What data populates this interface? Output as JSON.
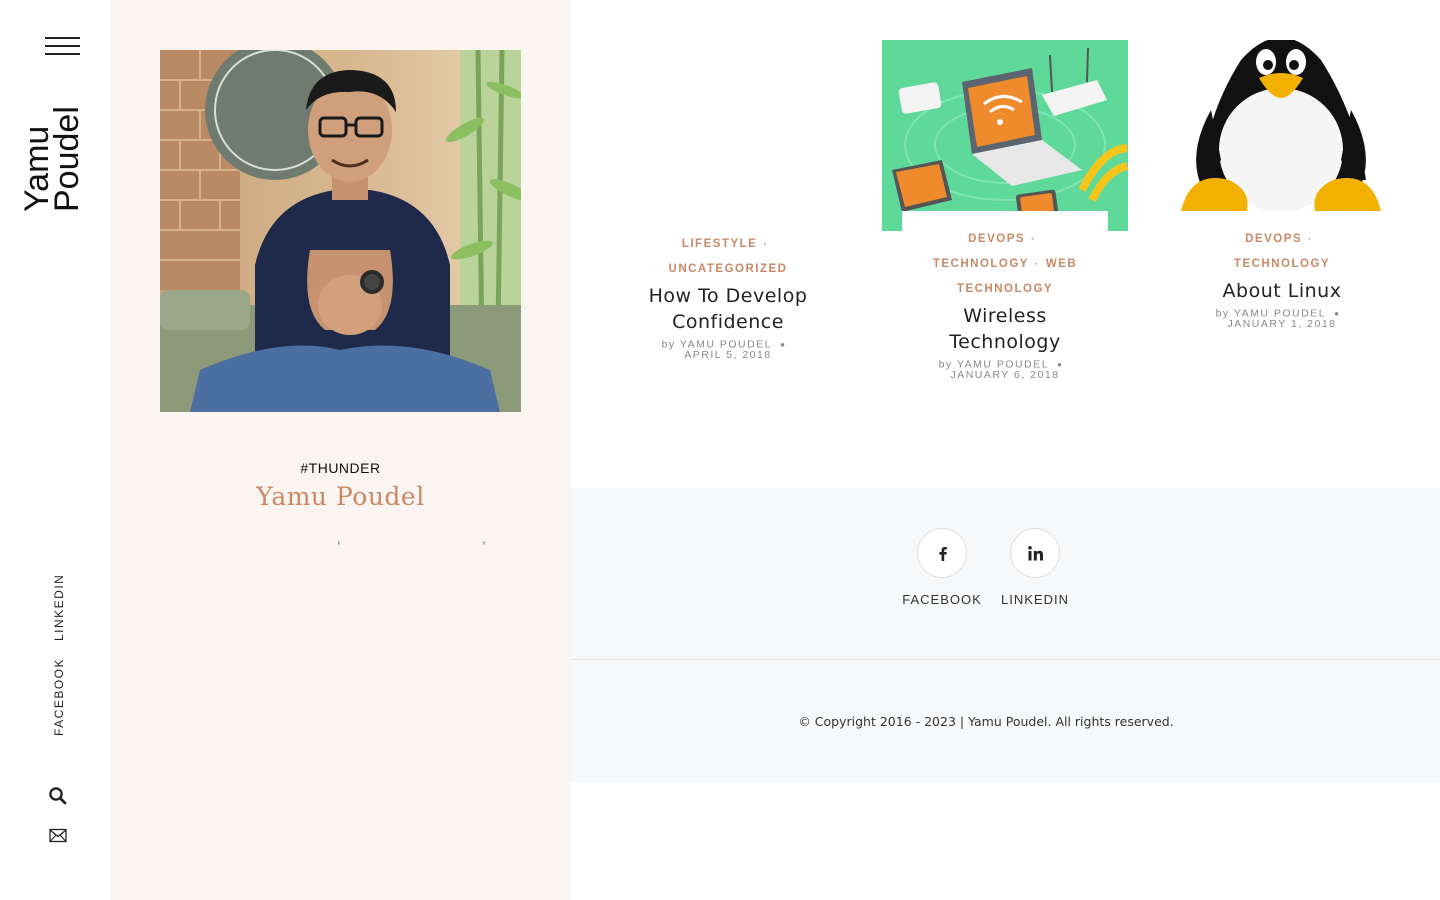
{
  "site": {
    "logo_line1": "Yamu",
    "logo_line2": "Poudel"
  },
  "sidebar": {
    "social": [
      {
        "label": "LINKEDIN"
      },
      {
        "label": "FACEBOOK"
      }
    ],
    "icons": [
      "search-icon",
      "mail-icon",
      "menu-icon"
    ]
  },
  "author": {
    "tag": "#THUNDER",
    "name": "Yamu Poudel",
    "bio_sep1": ",",
    "bio_sep2": ","
  },
  "posts": [
    {
      "categories": [
        "LIFESTYLE",
        "UNCATEGORIZED"
      ],
      "title_line1": "How To Develop",
      "title_line2": "Confidence",
      "by": "by",
      "author": "YAMU POUDEL",
      "date": "APRIL 5, 2018"
    },
    {
      "categories": [
        "DEVOPS",
        "TECHNOLOGY",
        "WEB TECHNOLOGY"
      ],
      "cat_web": "WEB",
      "cat_tech": "TECHNOLOGY",
      "title_line1": "Wireless",
      "title_line2": "Technology",
      "by": "by",
      "author": "YAMU POUDEL",
      "date": "JANUARY 6, 2018"
    },
    {
      "categories": [
        "DEVOPS",
        "TECHNOLOGY"
      ],
      "title": "About Linux",
      "by": "by",
      "author": "YAMU POUDEL",
      "date": "JANUARY 1, 2018"
    }
  ],
  "footer": {
    "social": [
      {
        "label": "FACEBOOK",
        "icon": "facebook-icon"
      },
      {
        "label": "LINKEDIN",
        "icon": "linkedin-icon"
      }
    ],
    "copyright_prefix": "© Copyright 2016 - 2023 | ",
    "copyright_link": "Yamu Poudel",
    "copyright_suffix": ". All rights reserved."
  },
  "colors": {
    "accent": "#c98966",
    "panel_bg": "#fbf5f2",
    "footer_bg": "#f7f8f9",
    "wireless_bg": "#5fd99a"
  }
}
